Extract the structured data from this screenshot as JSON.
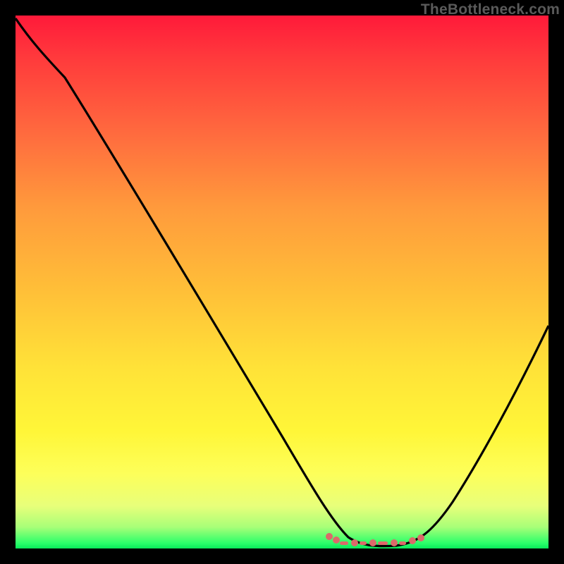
{
  "watermark": "TheBottleneck.com",
  "chart_data": {
    "type": "line",
    "title": "",
    "xlabel": "",
    "ylabel": "",
    "xlim": [
      0,
      100
    ],
    "ylim": [
      0,
      100
    ],
    "grid": false,
    "legend": false,
    "series": [
      {
        "name": "curve",
        "x": [
          0,
          4,
          10,
          20,
          30,
          40,
          50,
          58,
          62,
          66,
          70,
          74,
          78,
          82,
          88,
          94,
          100
        ],
        "y": [
          99,
          95,
          90,
          76,
          61,
          46,
          31,
          18,
          11,
          6,
          3,
          1,
          1,
          3,
          11,
          24,
          42
        ]
      }
    ],
    "highlight_region": {
      "x_start": 58,
      "x_end": 78,
      "meaning": "minimum-plateau"
    },
    "background_gradient": {
      "direction": "top-to-bottom",
      "stops": [
        {
          "pos": 0,
          "color": "#ff1a3a"
        },
        {
          "pos": 50,
          "color": "#ffc038"
        },
        {
          "pos": 85,
          "color": "#fdff5a"
        },
        {
          "pos": 100,
          "color": "#08e85a"
        }
      ]
    }
  },
  "colors": {
    "frame": "#000000",
    "curve": "#000000",
    "highlight": "#db6a6a",
    "watermark": "#5a5a5a"
  }
}
